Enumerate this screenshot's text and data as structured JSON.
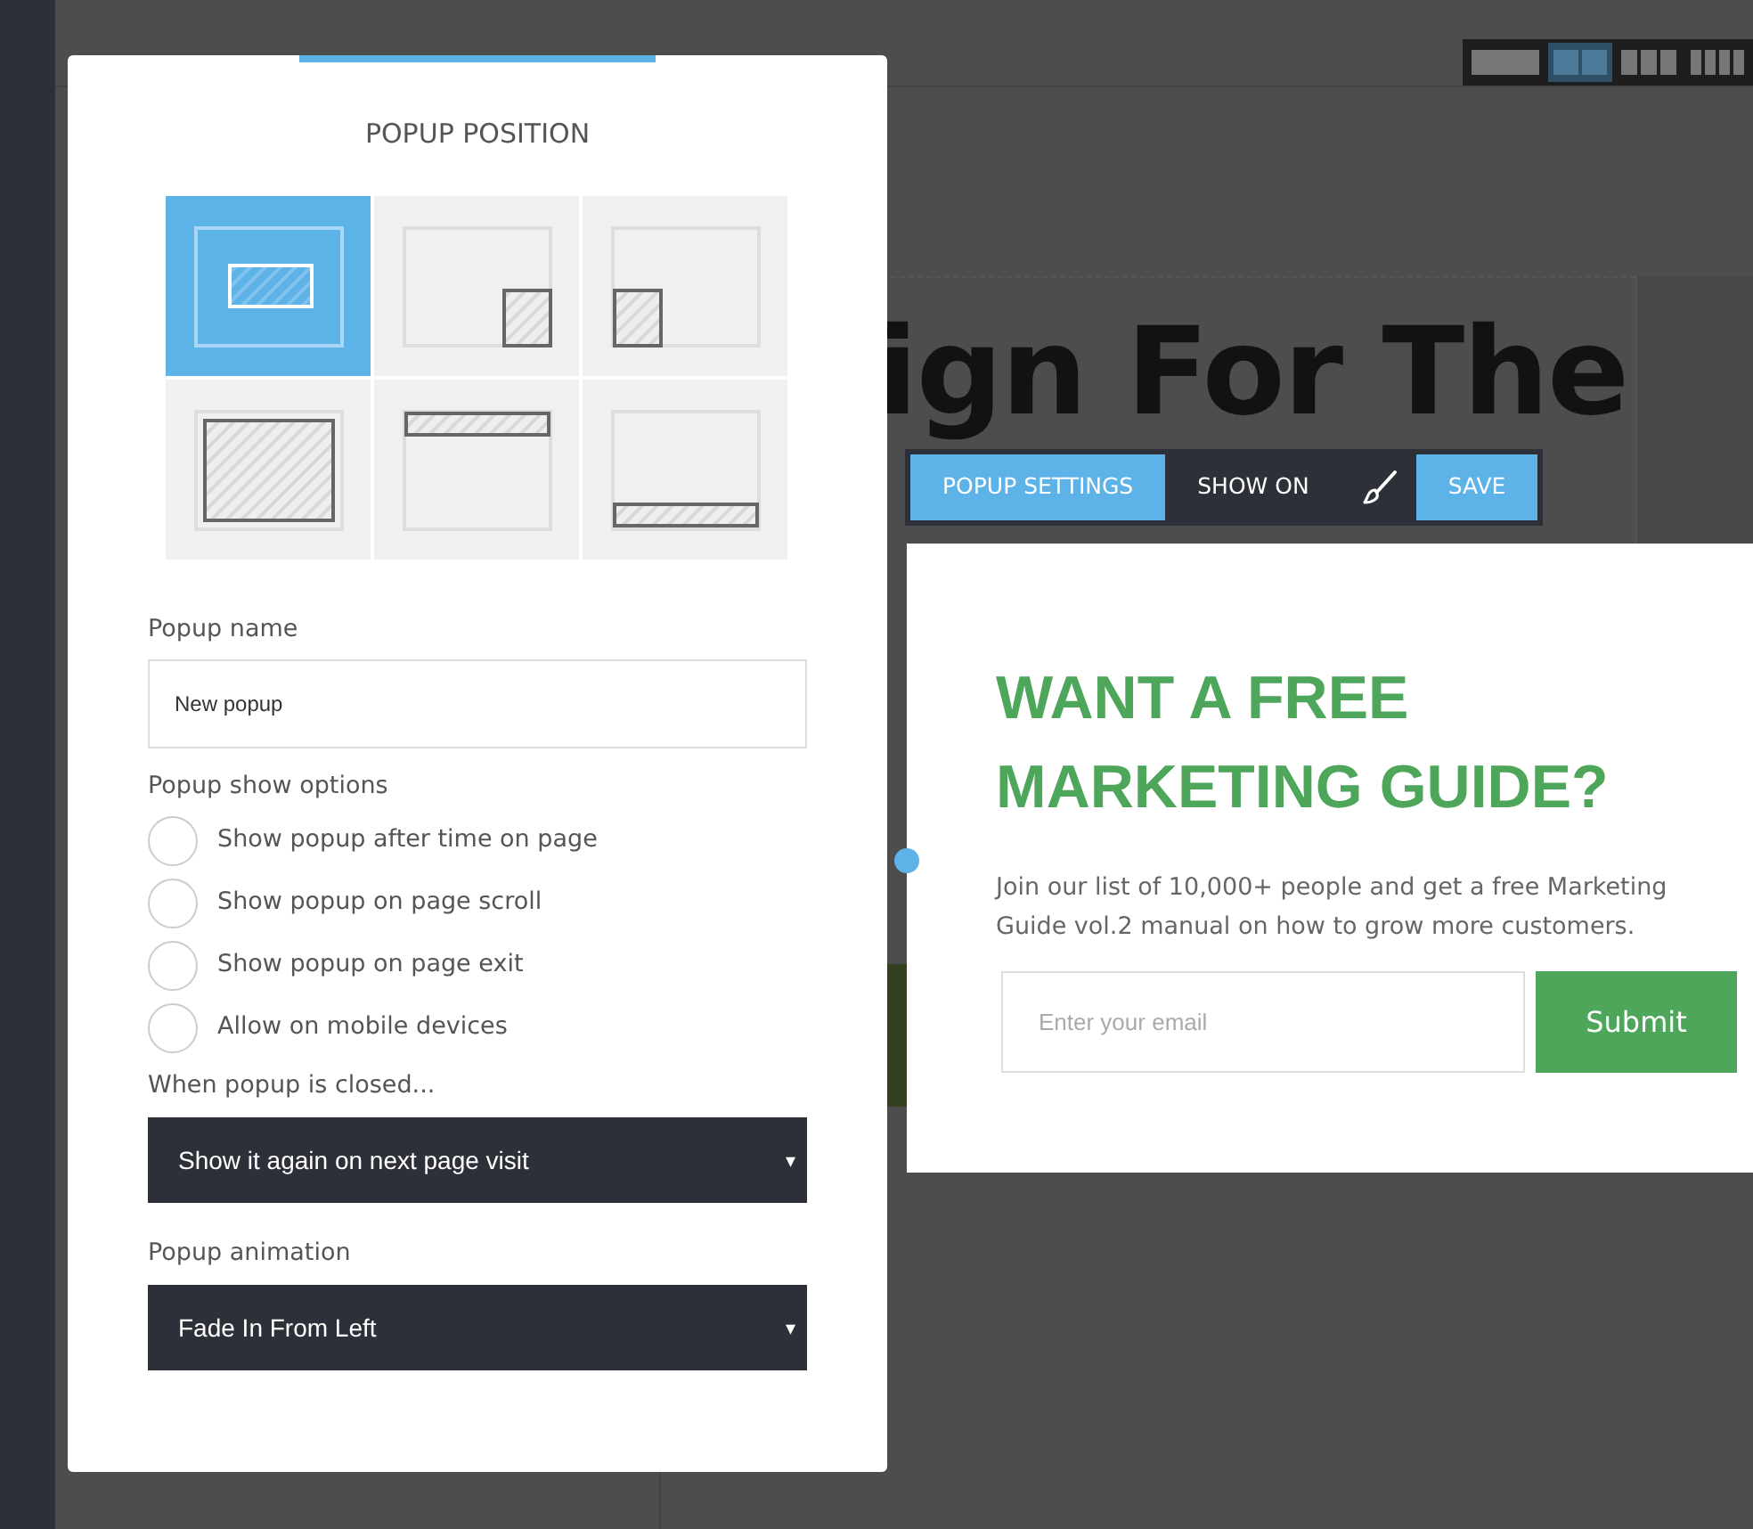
{
  "layout_switcher": [
    {
      "kind": "single",
      "selected": false
    },
    {
      "kind": "double",
      "selected": true
    },
    {
      "kind": "triple",
      "selected": false
    },
    {
      "kind": "quad",
      "selected": false
    }
  ],
  "background_page": {
    "heading": "ign For The"
  },
  "settings_panel": {
    "title": "POPUP POSITION",
    "positions": [
      {
        "kind": "center",
        "selected": true
      },
      {
        "kind": "bottom-right",
        "selected": false
      },
      {
        "kind": "bottom-left",
        "selected": false
      },
      {
        "kind": "fullscreen",
        "selected": false
      },
      {
        "kind": "top-bar",
        "selected": false
      },
      {
        "kind": "bottom-bar",
        "selected": false
      }
    ],
    "name_label": "Popup name",
    "name_value": "New popup",
    "show_options_label": "Popup show options",
    "show_options": [
      {
        "label": "Show popup after time on page",
        "checked": false
      },
      {
        "label": "Show popup on page scroll",
        "checked": false
      },
      {
        "label": "Show popup on page exit",
        "checked": false
      },
      {
        "label": "Allow on mobile devices",
        "checked": false
      }
    ],
    "closed_label": "When popup is closed...",
    "closed_select": {
      "value": "Show it again on next page visit",
      "caret": "▾"
    },
    "animation_label": "Popup animation",
    "animation_select": {
      "value": "Fade In From Left",
      "caret": "▾"
    }
  },
  "toolbar": [
    {
      "kind": "button",
      "label": "POPUP SETTINGS"
    },
    {
      "kind": "link",
      "label": "SHOW ON"
    },
    {
      "kind": "brush"
    },
    {
      "kind": "button",
      "label": "SAVE"
    }
  ],
  "popup": {
    "title": "WANT A FREE MARKETING GUIDE?",
    "text": "Join our list of 10,000+ people and get a free Marketing Guide vol.2 manual on how to grow more customers.",
    "email_placeholder": "Enter your email",
    "submit": "Submit"
  }
}
